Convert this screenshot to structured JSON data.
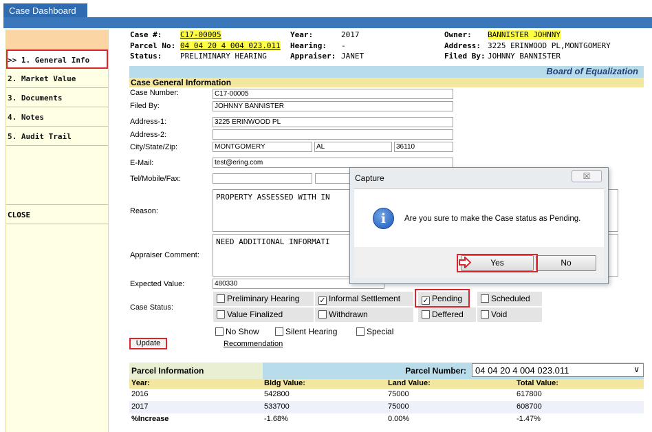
{
  "window": {
    "title": "Case Dashboard"
  },
  "sidebar": {
    "items": [
      {
        "label": ">> 1. General Info"
      },
      {
        "label": "2. Market Value"
      },
      {
        "label": "3. Documents"
      },
      {
        "label": "4. Notes"
      },
      {
        "label": "5. Audit Trail"
      }
    ],
    "close_label": "CLOSE"
  },
  "header": {
    "case_label": "Case #:",
    "case_value": "C17-00005",
    "parcel_label": "Parcel No:",
    "parcel_value": "04 04 20 4 004 023.011",
    "status_label": "Status:",
    "status_value": "PRELIMINARY HEARING",
    "year_label": "Year:",
    "year_value": "2017",
    "hearing_label": "Hearing:",
    "hearing_value": "-",
    "appraiser_label": "Appraiser:",
    "appraiser_value": "JANET",
    "owner_label": "Owner:",
    "owner_value": "BANNISTER JOHNNY",
    "address_label": "Address:",
    "address_value": "3225 ERINWOOD PL,MONTGOMERY",
    "filedby_label": "Filed By:",
    "filedby_value": "JOHNNY BANNISTER"
  },
  "board_title": "Board of Equalization",
  "section_title": "Case General Information",
  "form": {
    "case_number_label": "Case Number:",
    "case_number": "C17-00005",
    "filed_by_label": "Filed By:",
    "filed_by": "JOHNNY BANNISTER",
    "address1_label": "Address-1:",
    "address1": "3225 ERINWOOD PL",
    "address2_label": "Address-2:",
    "address2": "",
    "csz_label": "City/State/Zip:",
    "city": "MONTGOMERY",
    "state": "AL",
    "zip": "36110",
    "email_label": "E-Mail:",
    "email": "test@ering.com",
    "tel_label": "Tel/Mobile/Fax:",
    "tel": "",
    "mobile": "",
    "reason_label": "Reason:",
    "reason": "PROPERTY ASSESSED WITH IN",
    "appraiser_comment_label": "Appraiser Comment:",
    "appraiser_comment": "NEED ADDITIONAL INFORMATI",
    "expected_value_label": "Expected Value:",
    "expected_value": "480330",
    "case_status_label": "Case Status:"
  },
  "status_options": {
    "preliminary_hearing": {
      "label": "Preliminary Hearing",
      "checked": false
    },
    "informal_settlement": {
      "label": "Informal Settlement",
      "checked": true
    },
    "pending": {
      "label": "Pending",
      "checked": true
    },
    "scheduled": {
      "label": "Scheduled",
      "checked": false
    },
    "value_finalized": {
      "label": "Value Finalized",
      "checked": false
    },
    "withdrawn": {
      "label": "Withdrawn",
      "checked": false
    },
    "deffered": {
      "label": "Deffered",
      "checked": false
    },
    "void": {
      "label": "Void",
      "checked": false
    }
  },
  "extra_options": {
    "no_show": "No Show",
    "silent_hearing": "Silent Hearing",
    "special": "Special"
  },
  "update_label": "Update",
  "recommendation_label": "Recommendation",
  "parcel_info": {
    "title": "Parcel Information",
    "number_label": "Parcel Number:",
    "number_value": "04 04 20 4 004 023.011",
    "columns": [
      "Year:",
      "Bldg Value:",
      "Land Value:",
      "Total Value:"
    ],
    "rows": [
      [
        "2016",
        "542800",
        "75000",
        "617800"
      ],
      [
        "2017",
        "533700",
        "75000",
        "608700"
      ],
      [
        "%Increase",
        "-1.68%",
        "0.00%",
        "-1.47%"
      ]
    ]
  },
  "dialog": {
    "title": "Capture",
    "close_symbol": "☒",
    "message": "Are you sure to make the Case status as Pending.",
    "yes_label": "Yes",
    "no_label": "No"
  },
  "colors": {
    "accent": "#3b78bb",
    "highlight": "#ffff44",
    "callout": "#d9252b"
  }
}
